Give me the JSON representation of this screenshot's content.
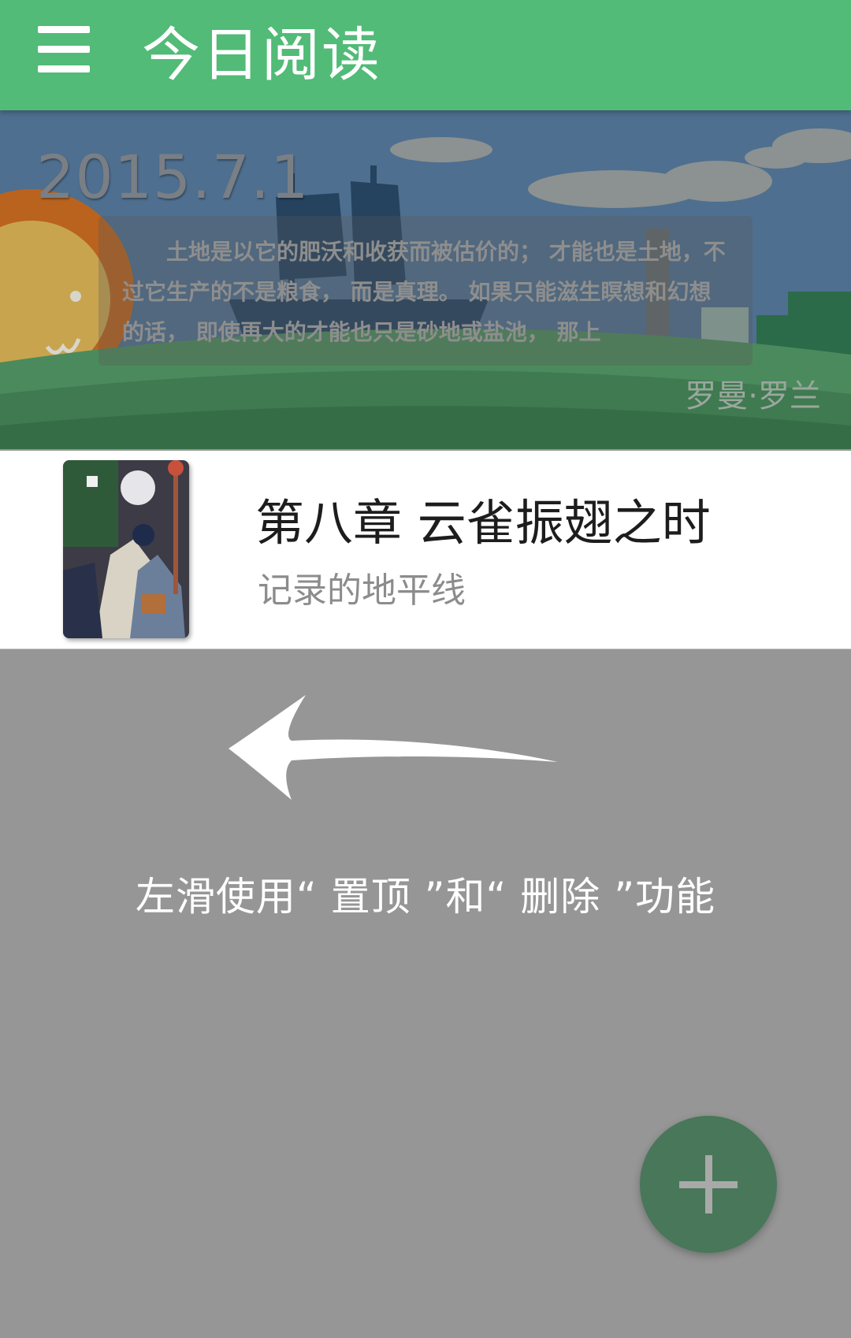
{
  "appbar": {
    "title": "今日阅读"
  },
  "banner": {
    "date": "2015.7.1",
    "quote": "土地是以它的肥沃和收获而被估价的； 才能也是土地，不过它生产的不是粮食， 而是真理。 如果只能滋生瞑想和幻想的话， 即使再大的才能也只是砂地或盐池， 那上",
    "author": "罗曼·罗兰"
  },
  "book": {
    "chapter": "第八章 云雀振翅之时",
    "name": "记录的地平线"
  },
  "hint": {
    "text": "左滑使用“ 置顶 ”和“ 删除 ”功能"
  },
  "fab": {
    "icon": "plus-icon"
  },
  "colors": {
    "appbar": "#51bb77",
    "overlay": "#969696",
    "fab": "#48775a"
  }
}
